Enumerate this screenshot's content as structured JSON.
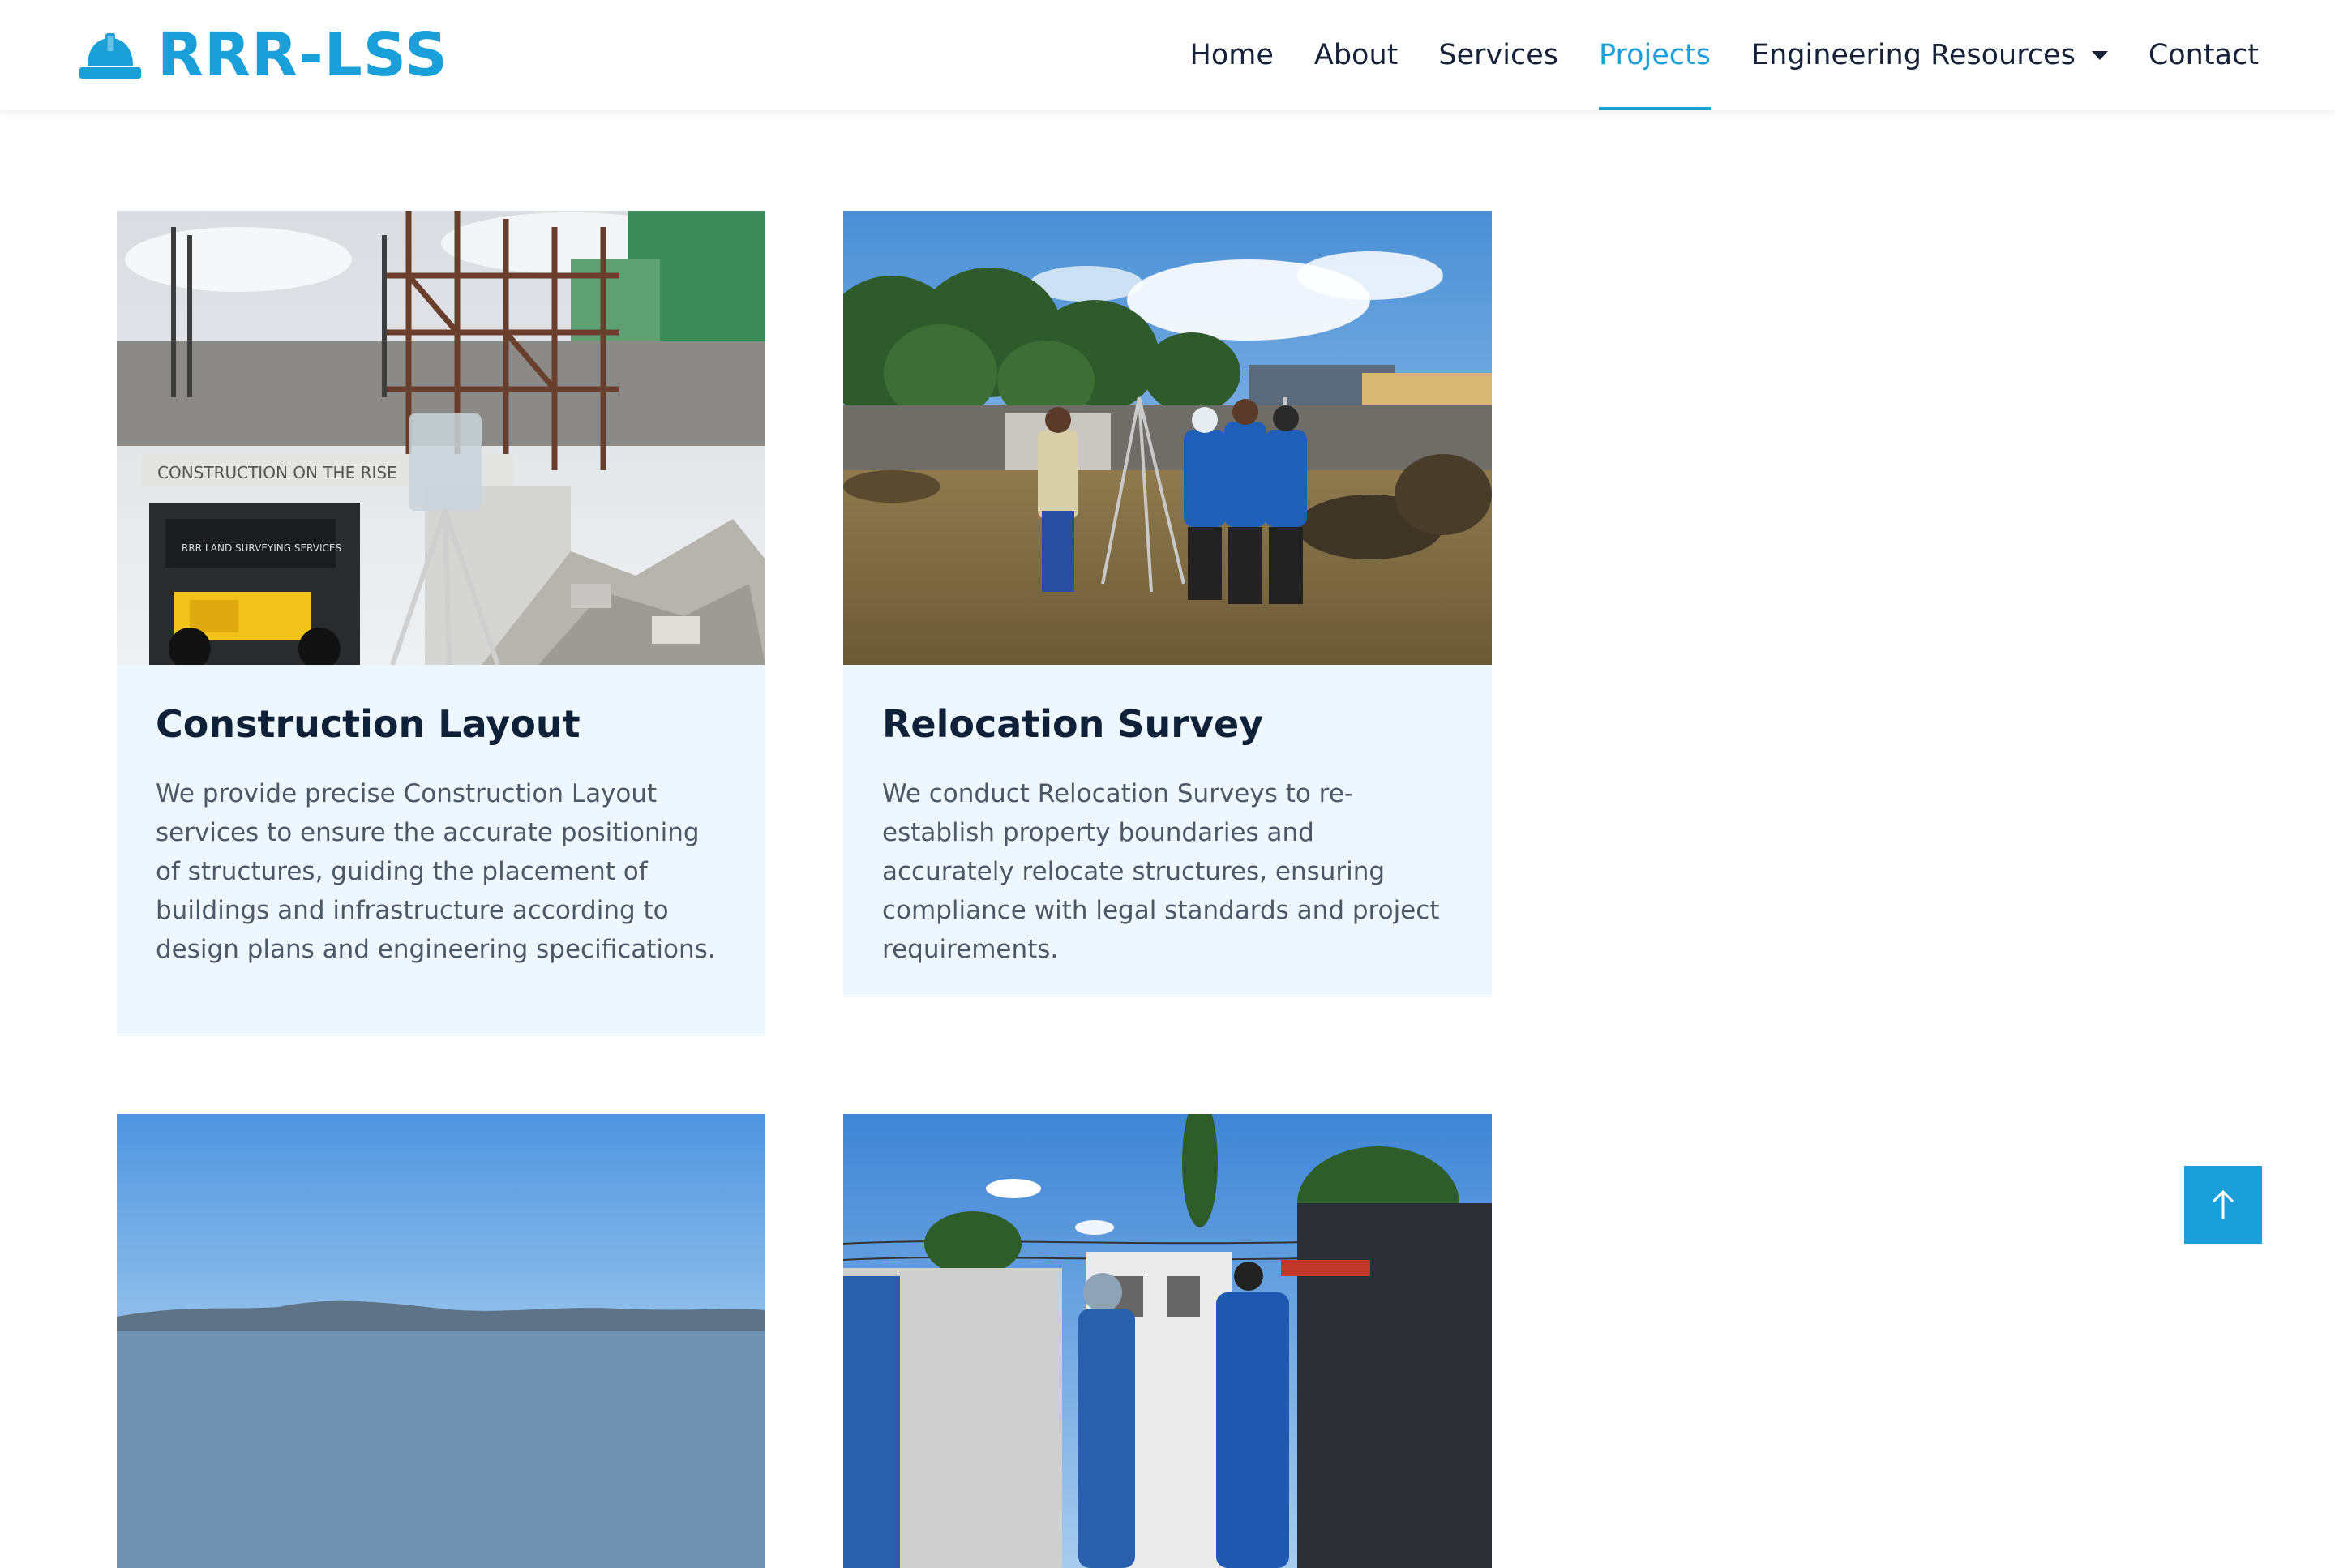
{
  "brand": {
    "name": "RRR-LSS",
    "icon": "hard-hat-icon",
    "color": "#1a9fd8"
  },
  "nav": {
    "home": "Home",
    "about": "About",
    "services": "Services",
    "projects": "Projects",
    "engineering_resources": "Engineering Resources",
    "contact": "Contact",
    "active": "Projects"
  },
  "projects": [
    {
      "title": "Construction Layout",
      "description": "We provide precise Construction Layout services to ensure the accurate positioning of structures, guiding the placement of buildings and infrastructure according to design plans and engineering specifications.",
      "image": "construction-site-photo"
    },
    {
      "title": "Relocation Survey",
      "description": "We conduct Relocation Surveys to re-establish property boundaries and accurately relocate structures, ensuring compliance with legal standards and project requirements.",
      "image": "survey-team-field-photo"
    },
    {
      "image": "coastal-sky-photo"
    },
    {
      "image": "street-survey-photo"
    }
  ],
  "back_to_top": {
    "icon": "arrow-up-icon"
  },
  "colors": {
    "accent": "#1a9fd8",
    "card_bg": "#eef7fd",
    "heading": "#0f2138",
    "body_text": "#4d5866"
  }
}
